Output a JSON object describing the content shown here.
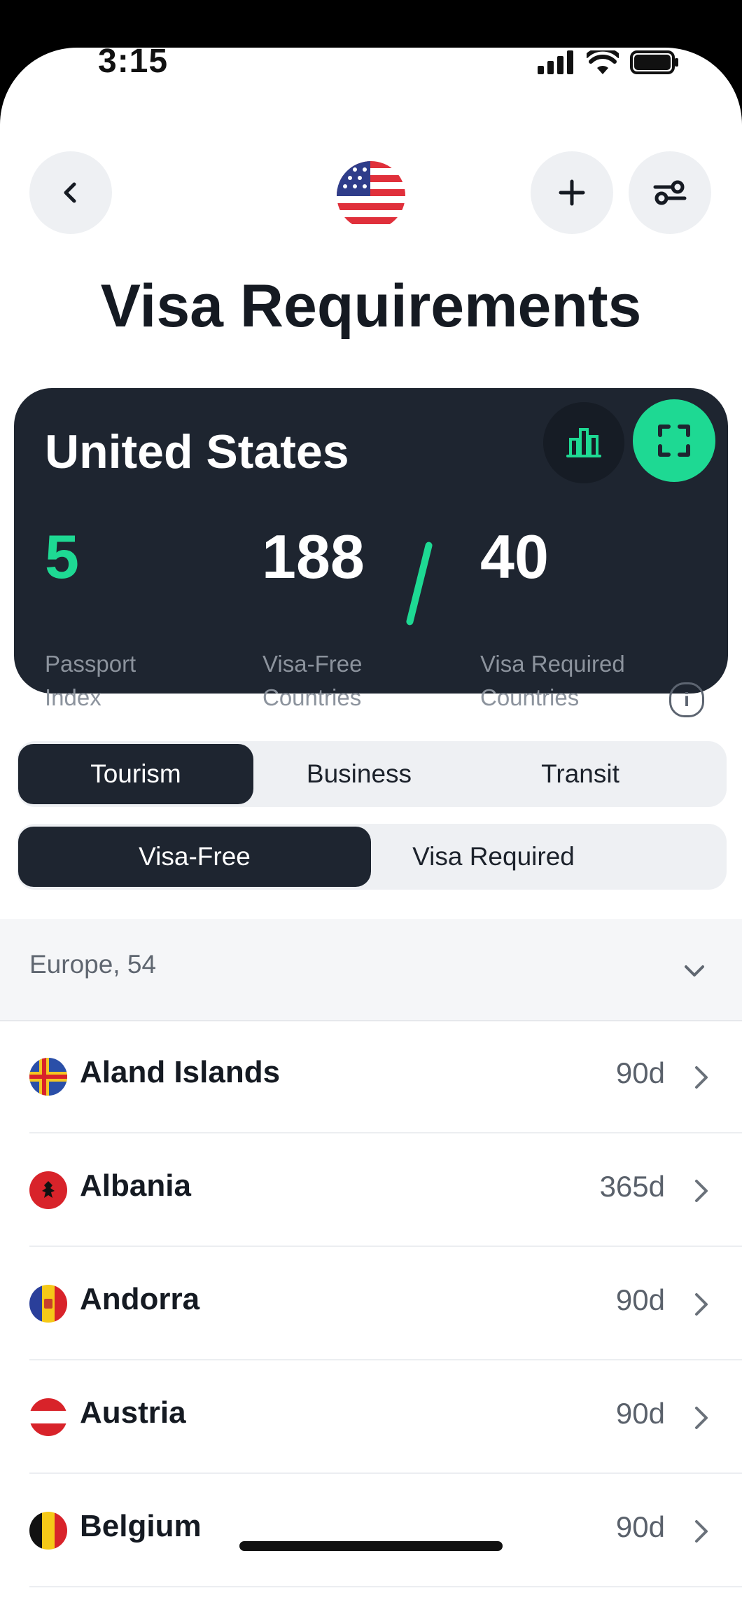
{
  "status": {
    "time": "3:15"
  },
  "header": {
    "title": "Visa Requirements"
  },
  "card": {
    "country": "United States",
    "passport_index": "5",
    "passport_index_label_1": "Passport",
    "passport_index_label_2": "Index",
    "visa_free": "188",
    "visa_free_label_1": "Visa-Free",
    "visa_free_label_2": "Countries",
    "visa_required": "40",
    "visa_required_label_1": "Visa Required",
    "visa_required_label_2": "Countries",
    "accent": "#1ed993"
  },
  "purpose_tabs": [
    {
      "label": "Tourism",
      "active": true
    },
    {
      "label": "Business",
      "active": false
    },
    {
      "label": "Transit",
      "active": false
    }
  ],
  "visa_tabs": [
    {
      "label": "Visa-Free",
      "active": true
    },
    {
      "label": "Visa Required",
      "active": false
    }
  ],
  "group": {
    "label": "Europe, 54"
  },
  "countries": [
    {
      "name": "Aland Islands",
      "days": "90d",
      "flag": "aland-flag"
    },
    {
      "name": "Albania",
      "days": "365d",
      "flag": "albania-flag"
    },
    {
      "name": "Andorra",
      "days": "90d",
      "flag": "andorra-flag"
    },
    {
      "name": "Austria",
      "days": "90d",
      "flag": "austria-flag"
    },
    {
      "name": "Belgium",
      "days": "90d",
      "flag": "belgium-flag"
    }
  ]
}
